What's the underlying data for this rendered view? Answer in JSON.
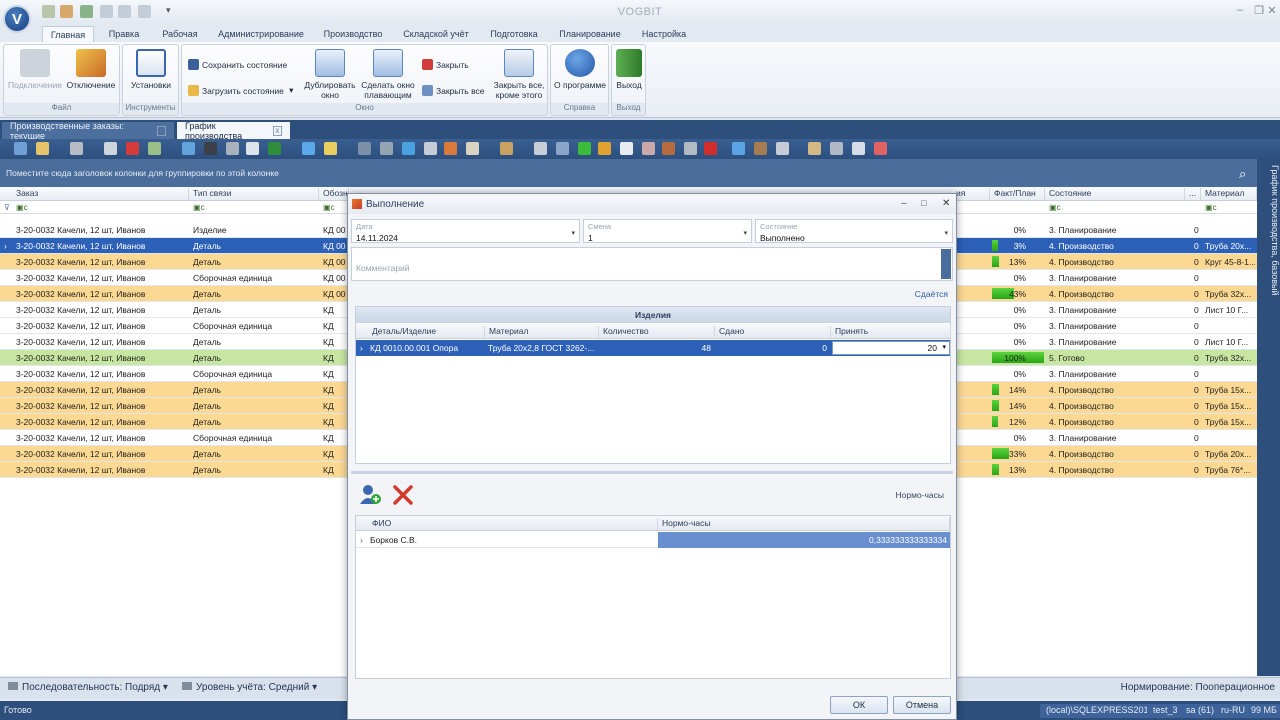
{
  "app": {
    "title": "VOGBIT",
    "logo_letter": "V"
  },
  "ribbon_tabs": [
    "Главная",
    "Правка",
    "Рабочая",
    "Администрирование",
    "Производство",
    "Складской учёт",
    "Подготовка",
    "Планирование",
    "Настройка"
  ],
  "ribbon": {
    "file": {
      "caption": "Файл",
      "connect": "Подключение",
      "disconnect": "Отключение"
    },
    "tools": {
      "caption": "Инструменты",
      "settings": "Установки"
    },
    "window": {
      "caption": "Окно",
      "save_state": "Сохранить состояние",
      "load_state": "Загрузить состояние",
      "duplicate": "Дублировать окно",
      "float": "Сделать окно плавающим",
      "close": "Закрыть",
      "close_all": "Закрыть все",
      "close_except": "Закрыть все, кроме этого"
    },
    "help": {
      "caption": "Справка",
      "about": "О программе"
    },
    "exit": {
      "caption": "Выход",
      "exit": "Выход"
    }
  },
  "doc_tabs": [
    "Производственные заказы: текущие",
    "График производства"
  ],
  "grid": {
    "group_hint": "Поместите сюда заголовок колонки для группировки по этой колонке",
    "side_tab": "График производства, базовый",
    "headers": {
      "order": "Заказ",
      "link": "Тип связи",
      "desig": "Обозн",
      "frag": "ия",
      "fact": "Факт/План",
      "state": "Состояние",
      "dots": "...",
      "material": "Материал"
    },
    "filter_text": "с",
    "rows": [
      {
        "order": "3-20-0032 Качели, 12 шт, Иванов",
        "link": "Изделие",
        "desig": "КД 00",
        "fact": "0%",
        "pct": 0,
        "state": "3. Планирование",
        "n": "0",
        "mat": "",
        "style": ""
      },
      {
        "order": "3-20-0032 Качели, 12 шт, Иванов",
        "link": "Деталь",
        "desig": "КД 00",
        "fact": "3%",
        "pct": 3,
        "state": "4. Производство",
        "n": "0",
        "mat": "Труба 20х...",
        "style": "sel"
      },
      {
        "order": "3-20-0032 Качели, 12 шт, Иванов",
        "link": "Деталь",
        "desig": "КД 00",
        "fact": "13%",
        "pct": 13,
        "state": "4. Производство",
        "n": "0",
        "mat": "Круг 45-8-1...",
        "style": "orange"
      },
      {
        "order": "3-20-0032 Качели, 12 шт, Иванов",
        "link": "Сборочная единица",
        "desig": "КД 00",
        "fact": "0%",
        "pct": 0,
        "state": "3. Планирование",
        "n": "0",
        "mat": "",
        "style": ""
      },
      {
        "order": "3-20-0032 Качели, 12 шт, Иванов",
        "link": "Деталь",
        "desig": "КД 00",
        "fact": "43%",
        "pct": 43,
        "state": "4. Производство",
        "n": "0",
        "mat": "Труба 32х...",
        "style": "orange"
      },
      {
        "order": "3-20-0032 Качели, 12 шт, Иванов",
        "link": "Деталь",
        "desig": "КД",
        "fact": "0%",
        "pct": 0,
        "state": "3. Планирование",
        "n": "0",
        "mat": "Лист 10 Г...",
        "style": ""
      },
      {
        "order": "3-20-0032 Качели, 12 шт, Иванов",
        "link": "Сборочная единица",
        "desig": "КД",
        "fact": "0%",
        "pct": 0,
        "state": "3. Планирование",
        "n": "0",
        "mat": "",
        "style": ""
      },
      {
        "order": "3-20-0032 Качели, 12 шт, Иванов",
        "link": "Деталь",
        "desig": "КД",
        "fact": "0%",
        "pct": 0,
        "state": "3. Планирование",
        "n": "0",
        "mat": "Лист 10 Г...",
        "style": ""
      },
      {
        "order": "3-20-0032 Качели, 12 шт, Иванов",
        "link": "Деталь",
        "desig": "КД",
        "fact": "100%",
        "pct": 100,
        "state": "5. Готово",
        "n": "0",
        "mat": "Труба 32х...",
        "style": "green"
      },
      {
        "order": "3-20-0032 Качели, 12 шт, Иванов",
        "link": "Сборочная единица",
        "desig": "КД",
        "fact": "0%",
        "pct": 0,
        "state": "3. Планирование",
        "n": "0",
        "mat": "",
        "style": ""
      },
      {
        "order": "3-20-0032 Качели, 12 шт, Иванов",
        "link": "Деталь",
        "desig": "КД",
        "fact": "14%",
        "pct": 14,
        "state": "4. Производство",
        "n": "0",
        "mat": "Труба 15х...",
        "style": "orange"
      },
      {
        "order": "3-20-0032 Качели, 12 шт, Иванов",
        "link": "Деталь",
        "desig": "КД",
        "fact": "14%",
        "pct": 14,
        "state": "4. Производство",
        "n": "0",
        "mat": "Труба 15х...",
        "style": "orange"
      },
      {
        "order": "3-20-0032 Качели, 12 шт, Иванов",
        "link": "Деталь",
        "desig": "КД",
        "fact": "12%",
        "pct": 12,
        "state": "4. Производство",
        "n": "0",
        "mat": "Труба 15х...",
        "style": "orange"
      },
      {
        "order": "3-20-0032 Качели, 12 шт, Иванов",
        "link": "Сборочная единица",
        "desig": "КД",
        "fact": "0%",
        "pct": 0,
        "state": "3. Планирование",
        "n": "0",
        "mat": "",
        "style": ""
      },
      {
        "order": "3-20-0032 Качели, 12 шт, Иванов",
        "link": "Деталь",
        "desig": "КД",
        "fact": "33%",
        "pct": 33,
        "state": "4. Производство",
        "n": "0",
        "mat": "Труба 20х...",
        "style": "orange"
      },
      {
        "order": "3-20-0032 Качели, 12 шт, Иванов",
        "link": "Деталь",
        "desig": "КД",
        "fact": "13%",
        "pct": 13,
        "state": "4. Производство",
        "n": "0",
        "mat": "Труба 76*...",
        "style": "orange"
      }
    ]
  },
  "bottombar": {
    "sequence": "Последовательность: Подряд",
    "level": "Уровень учёта: Средний",
    "norming": "Нормирование: Пооперационное"
  },
  "status": {
    "ready": "Готово",
    "server": "(local)\\SQLEXPRESS2019",
    "db": "test_3",
    "user": "sa (61)",
    "locale": "ru-RU",
    "mem": "99 МБ"
  },
  "dialog": {
    "title": "Выполнение",
    "date": {
      "caption": "Дата",
      "value": "14.11.2024"
    },
    "shift": {
      "caption": "Смена",
      "value": "1"
    },
    "state": {
      "caption": "Состояние",
      "value": "Выполнено"
    },
    "comment_placeholder": "Комментарий",
    "handover": "Сдаётся",
    "items": {
      "caption": "Изделия",
      "headers": {
        "part": "Деталь/Изделие",
        "material": "Материал",
        "qty": "Количество",
        "given": "Сдано",
        "accept": "Принять"
      },
      "rows": [
        {
          "part": "КД 0010.00.001 Опора",
          "material": "Труба 20х2,8 ГОСТ 3262-...",
          "qty": "48",
          "given": "0",
          "accept": "20"
        }
      ]
    },
    "norm_label": "Нормо-часы",
    "workers": {
      "headers": {
        "name": "ФИО",
        "hours": "Нормо-часы"
      },
      "rows": [
        {
          "name": "Борков С.В.",
          "hours": "0,333333333333334"
        }
      ]
    },
    "ok": "ОК",
    "cancel": "Отмена"
  }
}
